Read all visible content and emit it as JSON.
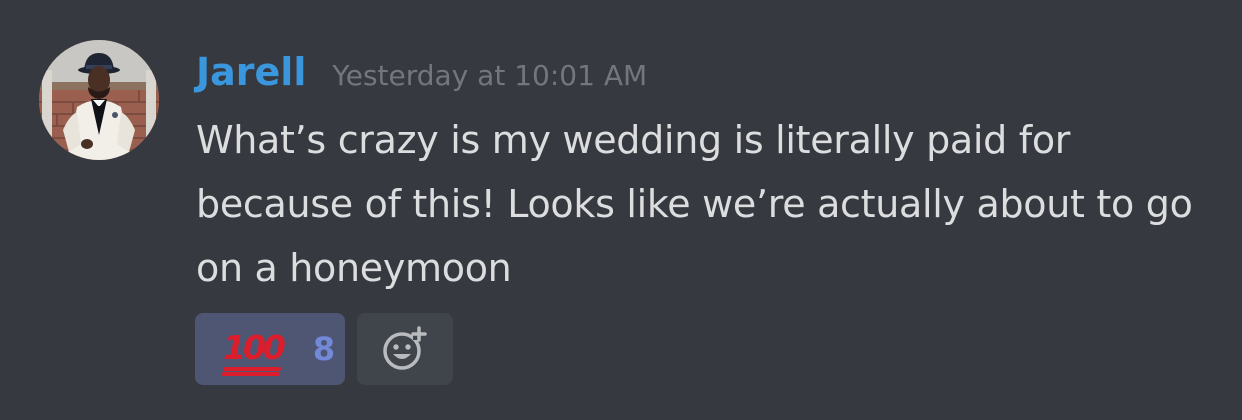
{
  "message": {
    "author": "Jarell",
    "timestamp": "Yesterday at 10:01 AM",
    "content": "What’s crazy is my wedding is literally paid for because of this! Looks like we’re actually about to go on a honeymoon",
    "avatar_icon": "avatar-photo-icon",
    "colors": {
      "background": "#36393f",
      "username": "#3a96dd",
      "timestamp": "#72767d",
      "text": "#dcddde",
      "reaction_bg": "#4e5673",
      "reaction_count": "#7289da",
      "add_reaction_bg": "#40444b"
    }
  },
  "reactions": [
    {
      "emoji": "💯",
      "emoji_text": "100",
      "icon": "hundred-points-icon",
      "count": "8",
      "active": true
    }
  ],
  "add_reaction": {
    "icon": "add-reaction-icon"
  }
}
